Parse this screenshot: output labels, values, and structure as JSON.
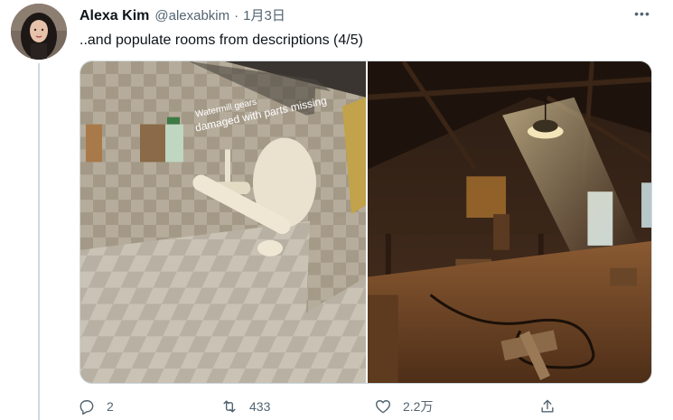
{
  "tweet": {
    "author_name": "Alexa Kim",
    "handle": "@alexabkim",
    "separator": "·",
    "date": "1月3日",
    "text": "..and populate rooms from descriptions (4/5)",
    "more_label": "•••"
  },
  "media": {
    "left_caption_line1": "Watermill gears",
    "left_caption_line2": "damaged with parts missing"
  },
  "actions": {
    "reply_count": "2",
    "retweet_count": "433",
    "like_count": "2.2万",
    "reply_icon": "reply-icon",
    "retweet_icon": "retweet-icon",
    "like_icon": "heart-icon",
    "share_icon": "share-icon"
  },
  "colors": {
    "text_primary": "#0f1419",
    "text_secondary": "#536471",
    "border": "#cfd9de"
  }
}
